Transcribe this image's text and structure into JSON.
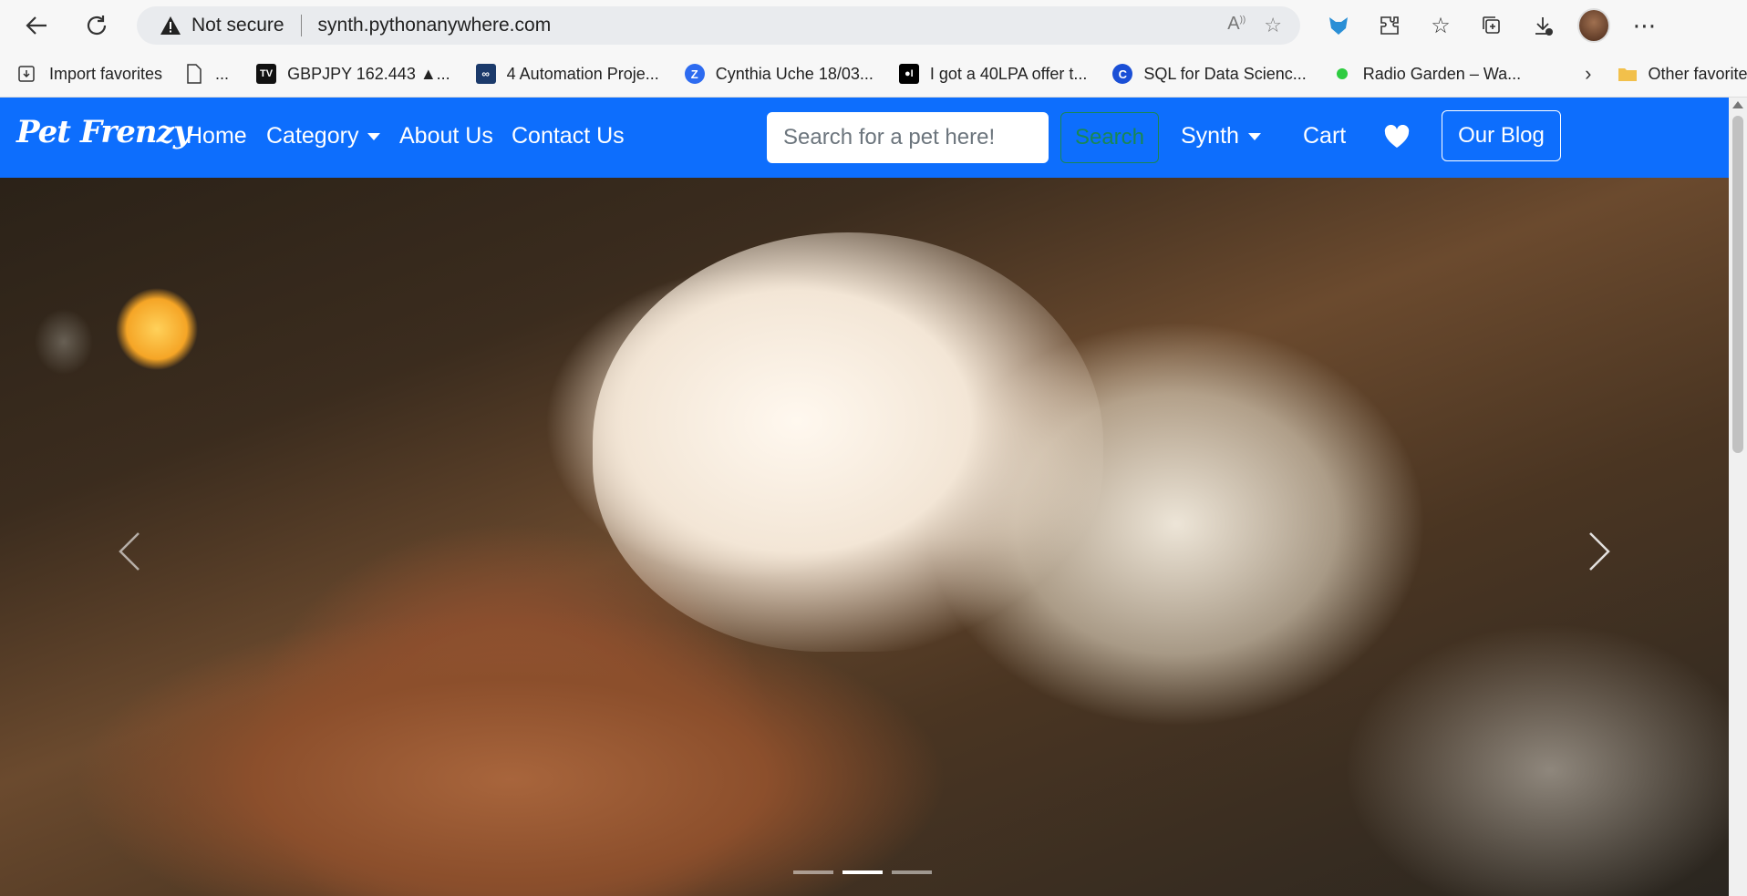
{
  "browser": {
    "address": {
      "security_label": "Not secure",
      "url": "synth.pythonanywhere.com"
    },
    "bookmarks": [
      {
        "label": "Import favorites",
        "icon": "import-icon"
      },
      {
        "label": "...",
        "icon": "page-icon"
      },
      {
        "label": "GBPJPY 162.443 ▲...",
        "icon": "tradingview-icon"
      },
      {
        "label": "4 Automation Proje...",
        "icon": "infinity-icon"
      },
      {
        "label": "Cynthia Uche 18/03...",
        "icon": "zoom-icon"
      },
      {
        "label": "I got a 40LPA offer t...",
        "icon": "medium-icon"
      },
      {
        "label": "SQL for Data Scienc...",
        "icon": "c-icon"
      },
      {
        "label": "Radio Garden – Wa...",
        "icon": "green-dot-icon"
      }
    ],
    "other_favorites": "Other favorites"
  },
  "site": {
    "brand": "Pet Frenzy",
    "nav": {
      "home": "Home",
      "category": "Category",
      "about": "About Us",
      "contact": "Contact Us",
      "user": "Synth",
      "cart": "Cart"
    },
    "search": {
      "placeholder": "Search for a pet here!",
      "button": "Search"
    },
    "blog_button": "Our Blog",
    "carousel": {
      "slides": 3,
      "active_index": 1,
      "prev_icon": "chevron-left-icon",
      "next_icon": "chevron-right-icon"
    }
  },
  "colors": {
    "navbar": "#0d6efd",
    "search_button": "#198754"
  }
}
